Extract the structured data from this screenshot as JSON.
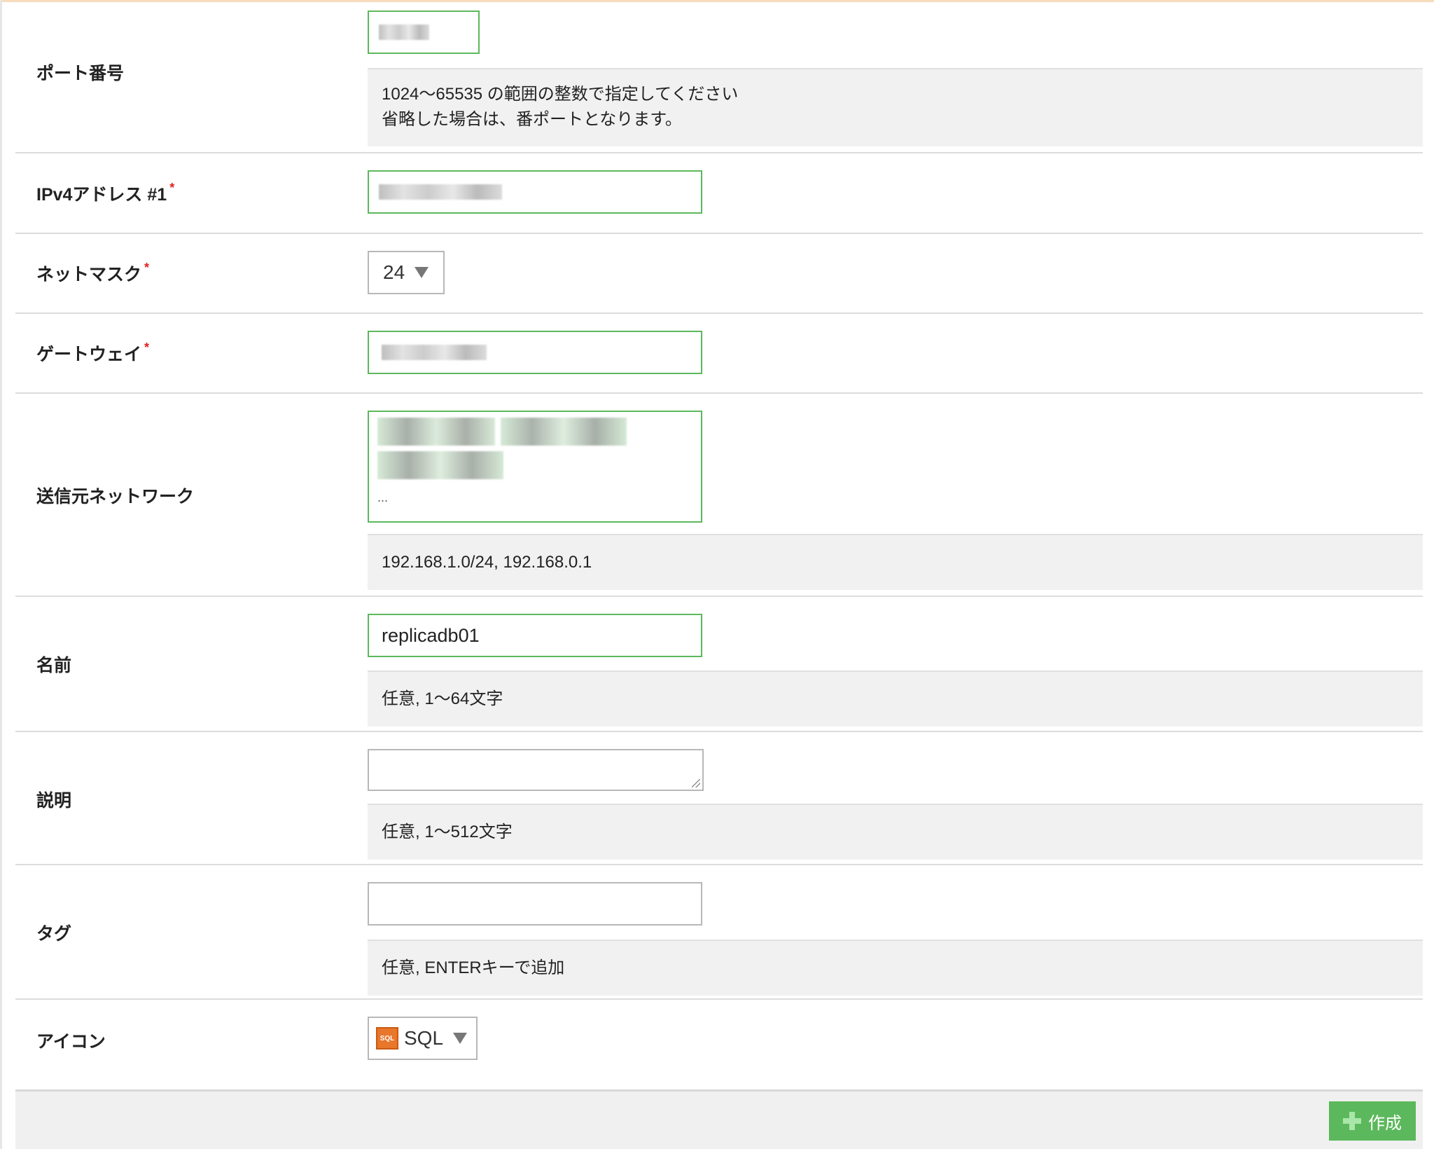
{
  "form": {
    "port": {
      "label": "ポート番号",
      "hint_line1": "1024〜65535 の範囲の整数で指定してください",
      "hint_line2": "省略した場合は、番ポートとなります。"
    },
    "ipv4": {
      "label": "IPv4アドレス #1",
      "required_mark": "*"
    },
    "netmask": {
      "label": "ネットマスク",
      "required_mark": "*",
      "selected": "24"
    },
    "gateway": {
      "label": "ゲートウェイ",
      "required_mark": "*"
    },
    "source_network": {
      "label": "送信元ネットワーク",
      "ellipsis": "...",
      "hint": "192.168.1.0/24, 192.168.0.1"
    },
    "name": {
      "label": "名前",
      "value": "replicadb01",
      "hint": "任意, 1〜64文字"
    },
    "description": {
      "label": "説明",
      "hint": "任意, 1〜512文字"
    },
    "tags": {
      "label": "タグ",
      "hint": "任意, ENTERキーで追加"
    },
    "icon": {
      "label": "アイコン",
      "selected": "SQL",
      "icon_name": "sql-icon",
      "icon_text": "SQL"
    }
  },
  "footer": {
    "create_label": "作成"
  },
  "colors": {
    "accent": "#5cb85c",
    "required": "#dd2222",
    "hint_bg": "#f1f1f1"
  }
}
